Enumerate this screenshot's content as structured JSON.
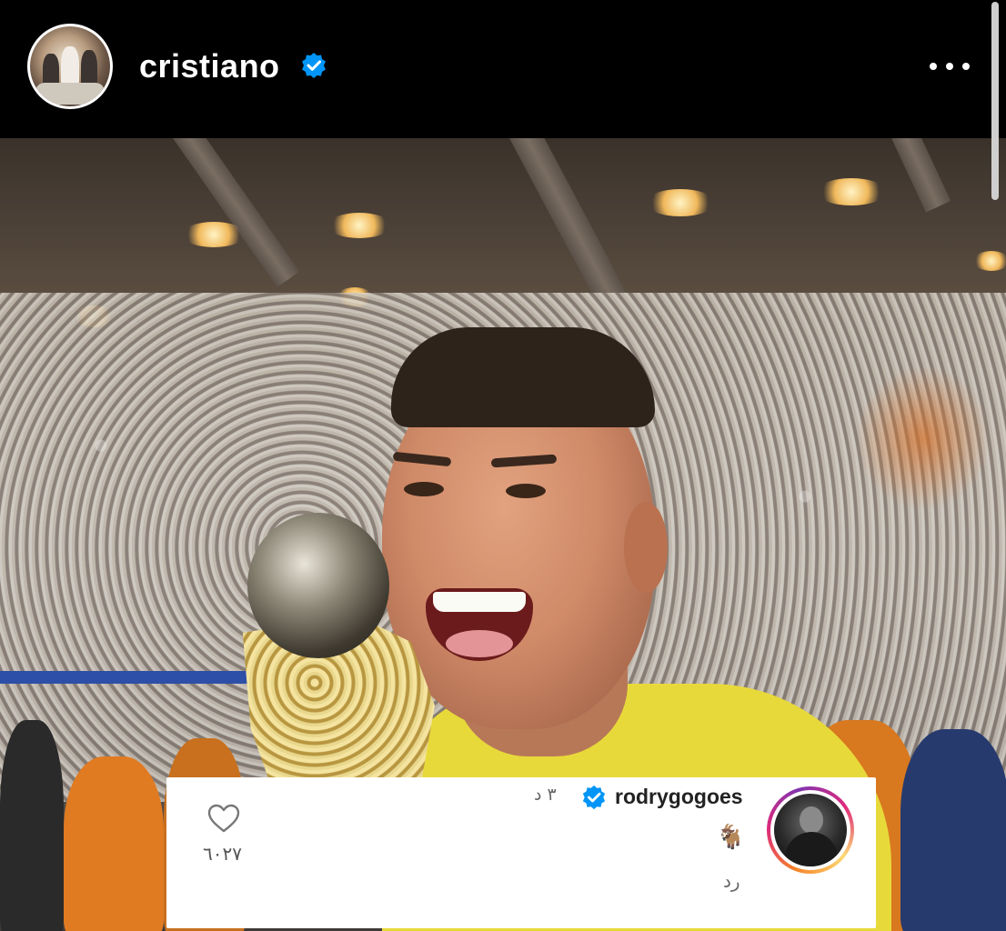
{
  "header": {
    "username": "cristiano",
    "verified_color": "#0095f6",
    "more_icon": "more-horizontal-icon"
  },
  "post": {
    "image_alt_colors": {
      "shirt": "#e8d93a",
      "banner": "#2d4fa8"
    }
  },
  "comment": {
    "username": "rodrygogoes",
    "time": "٣ د",
    "text": "🐐",
    "reply_label": "رد",
    "like_count": "٦٠٢٧",
    "heart_icon": "heart-outline-icon",
    "story_ring_colors": [
      "#f58529",
      "#dd2a7b",
      "#8134af",
      "#feda77"
    ]
  }
}
